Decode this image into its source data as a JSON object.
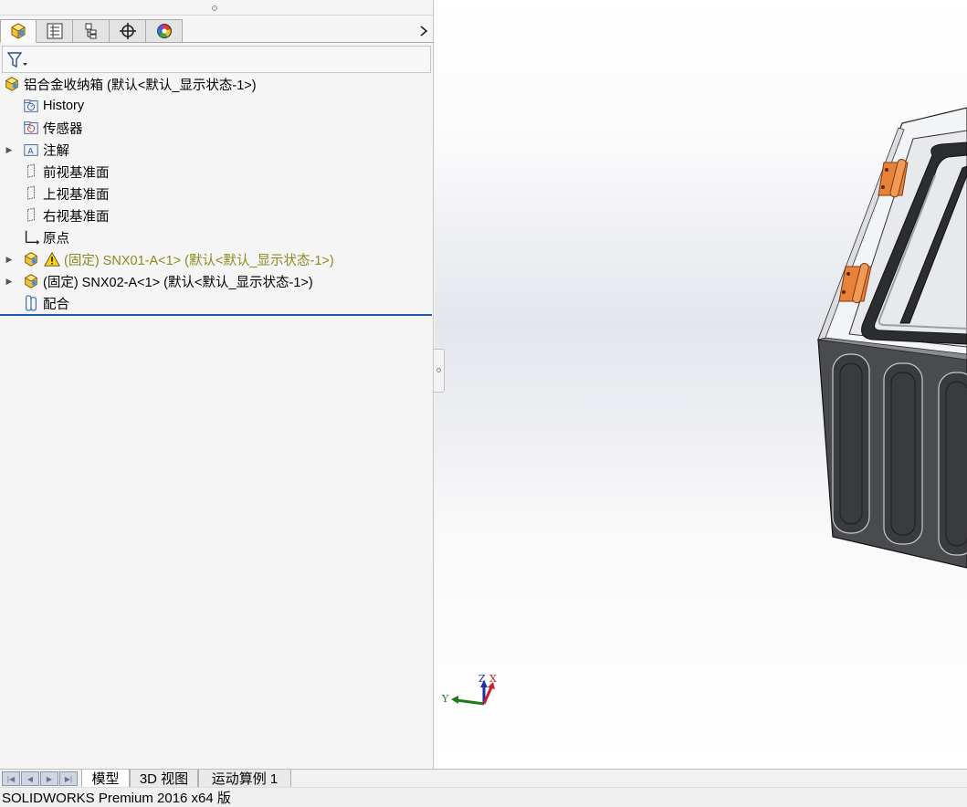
{
  "tabs": [
    {
      "name": "feature-manager",
      "icon": "part-cube-icon"
    },
    {
      "name": "property-manager",
      "icon": "property-list-icon"
    },
    {
      "name": "configuration-manager",
      "icon": "configuration-icon"
    },
    {
      "name": "dimxpert-manager",
      "icon": "crosshair-icon"
    },
    {
      "name": "display-manager",
      "icon": "color-wheel-icon"
    }
  ],
  "tree": {
    "root_label": "铝合金收纳箱  (默认<默认_显示状态-1>)",
    "items": [
      {
        "label": "History",
        "icon": "history-folder-icon"
      },
      {
        "label": "传感器",
        "icon": "sensor-folder-icon"
      },
      {
        "label": "注解",
        "icon": "annotation-folder-icon"
      },
      {
        "label": "前视基准面",
        "icon": "plane-icon"
      },
      {
        "label": "上视基准面",
        "icon": "plane-icon"
      },
      {
        "label": "右视基准面",
        "icon": "plane-icon"
      },
      {
        "label": "原点",
        "icon": "origin-icon"
      },
      {
        "label": "(固定) SNX01-A<1> (默认<默认_显示状态-1>)",
        "icon": "warning-icon",
        "status": "warning"
      },
      {
        "label": "(固定) SNX02-A<1> (默认<默认_显示状态-1>)",
        "icon": "part-icon"
      },
      {
        "label": "配合",
        "icon": "mate-icon"
      }
    ]
  },
  "triad": {
    "x": "X",
    "y": "Y",
    "z": "Z"
  },
  "bottom_tabs": [
    "模型",
    "3D 视图",
    "运动算例 1"
  ],
  "status_text": "SOLIDWORKS Premium 2016 x64 版",
  "colors": {
    "accent_line": "#1c5aa8",
    "warning_text": "#8c8a1f",
    "hinge": "#e8823a"
  }
}
